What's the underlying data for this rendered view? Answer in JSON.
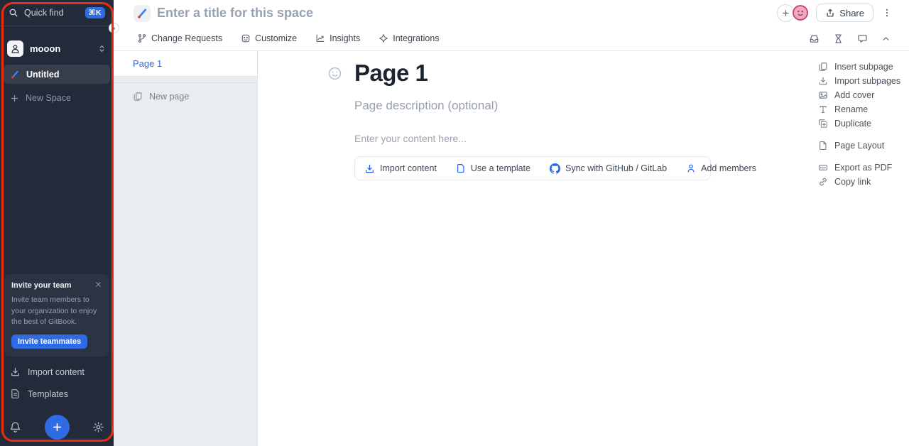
{
  "annotation": {
    "color": "#e92d13",
    "target": "left-sidebar"
  },
  "sidebar": {
    "search": {
      "label": "Quick find",
      "shortcut": "⌘K"
    },
    "workspace": {
      "name": "mooon"
    },
    "space_item": {
      "label": "Untitled"
    },
    "new_space": {
      "label": "New Space"
    },
    "invite_card": {
      "title": "Invite your team",
      "body": "Invite team members to your organization to enjoy the best of GitBook.",
      "button": "Invite teammates"
    },
    "footer_items": [
      {
        "icon": "import-icon",
        "label": "Import content"
      },
      {
        "icon": "templates-icon",
        "label": "Templates"
      }
    ]
  },
  "header": {
    "title_placeholder": "Enter a title for this space",
    "share_label": "Share"
  },
  "tabs": [
    {
      "icon": "git-branch-icon",
      "label": "Change Requests"
    },
    {
      "icon": "customize-icon",
      "label": "Customize"
    },
    {
      "icon": "insights-icon",
      "label": "Insights"
    },
    {
      "icon": "integrations-icon",
      "label": "Integrations"
    }
  ],
  "pages_panel": {
    "selected_page": "Page 1",
    "new_page_label": "New page"
  },
  "editor": {
    "page_title": "Page 1",
    "description_placeholder": "Page description (optional)",
    "content_placeholder": "Enter your content here...",
    "actions": [
      {
        "icon": "import-icon",
        "label": "Import content"
      },
      {
        "icon": "template-icon",
        "label": "Use a template"
      },
      {
        "icon": "github-icon",
        "label": "Sync with GitHub / GitLab"
      },
      {
        "icon": "person-icon",
        "label": "Add members"
      }
    ]
  },
  "page_menu": {
    "items": [
      {
        "icon": "pages-icon",
        "label": "Insert subpage"
      },
      {
        "icon": "import-icon",
        "label": "Import subpages"
      },
      {
        "icon": "image-icon",
        "label": "Add cover"
      },
      {
        "icon": "text-icon",
        "label": "Rename"
      },
      {
        "icon": "duplicate-icon",
        "label": "Duplicate"
      },
      {
        "icon": "layout-icon",
        "label": "Page Layout"
      },
      {
        "icon": "pdf-icon",
        "label": "Export as PDF"
      },
      {
        "icon": "link-icon",
        "label": "Copy link"
      }
    ]
  },
  "colors": {
    "accent_blue": "#2e6be5",
    "sidebar_bg": "#232b3a",
    "annotation_red": "#e92d13",
    "avatar_pink": "#f2a7c3"
  }
}
